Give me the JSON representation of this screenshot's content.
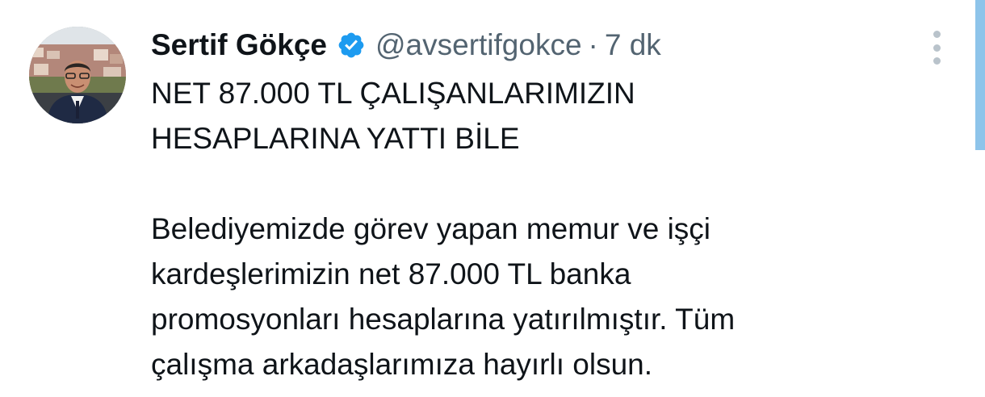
{
  "author": {
    "name": "Sertif Gökçe",
    "handle": "@avsertifgokce",
    "separator": "·",
    "time": "7 dk"
  },
  "icons": {
    "verified": "verified-badge-icon",
    "more": "more-options-icon",
    "verified_color": "#1d9bf0"
  },
  "tweet": {
    "headline_line1": "NET 87.000 TL ÇALIŞANLARIMIZIN",
    "headline_line2": "HESAPLARINA YATTI BİLE",
    "body_line1": "Belediyemizde görev yapan memur ve işçi",
    "body_line2": "kardeşlerimizin net 87.000 TL banka",
    "body_line3": "promosyonları hesaplarına yatırılmıştır. Tüm",
    "body_line4": "çalışma arkadaşlarımıza hayırlı olsun."
  }
}
